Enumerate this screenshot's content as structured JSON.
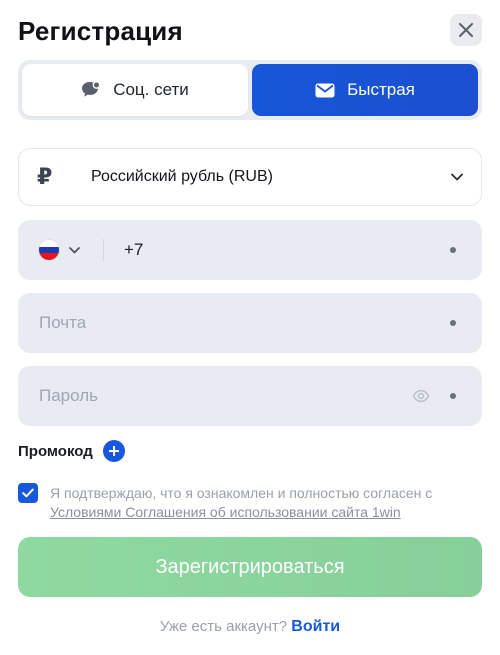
{
  "header": {
    "title": "Регистрация"
  },
  "tabs": {
    "social_label": "Соц. сети",
    "fast_label": "Быстрая",
    "active": "fast"
  },
  "currency": {
    "symbol": "₽",
    "label": "Российский рубль (RUB)"
  },
  "phone": {
    "country_flag": "russia-flag",
    "code": "+7"
  },
  "email": {
    "placeholder": "Почта"
  },
  "password": {
    "placeholder": "Пароль"
  },
  "promo": {
    "label": "Промокод"
  },
  "agreement": {
    "checked": true,
    "text": "Я подтверждаю, что я ознакомлен и полностью согласен с",
    "link": "Условиями Соглашения об использовании сайта 1win"
  },
  "actions": {
    "register_label": "Зарегистрироваться",
    "login_prompt": "Уже есть аккаунт?",
    "login_link": "Войти"
  },
  "colors": {
    "accent": "#1858dc",
    "register_button": "#8bd49e",
    "field_bg": "#e9ebf3"
  }
}
